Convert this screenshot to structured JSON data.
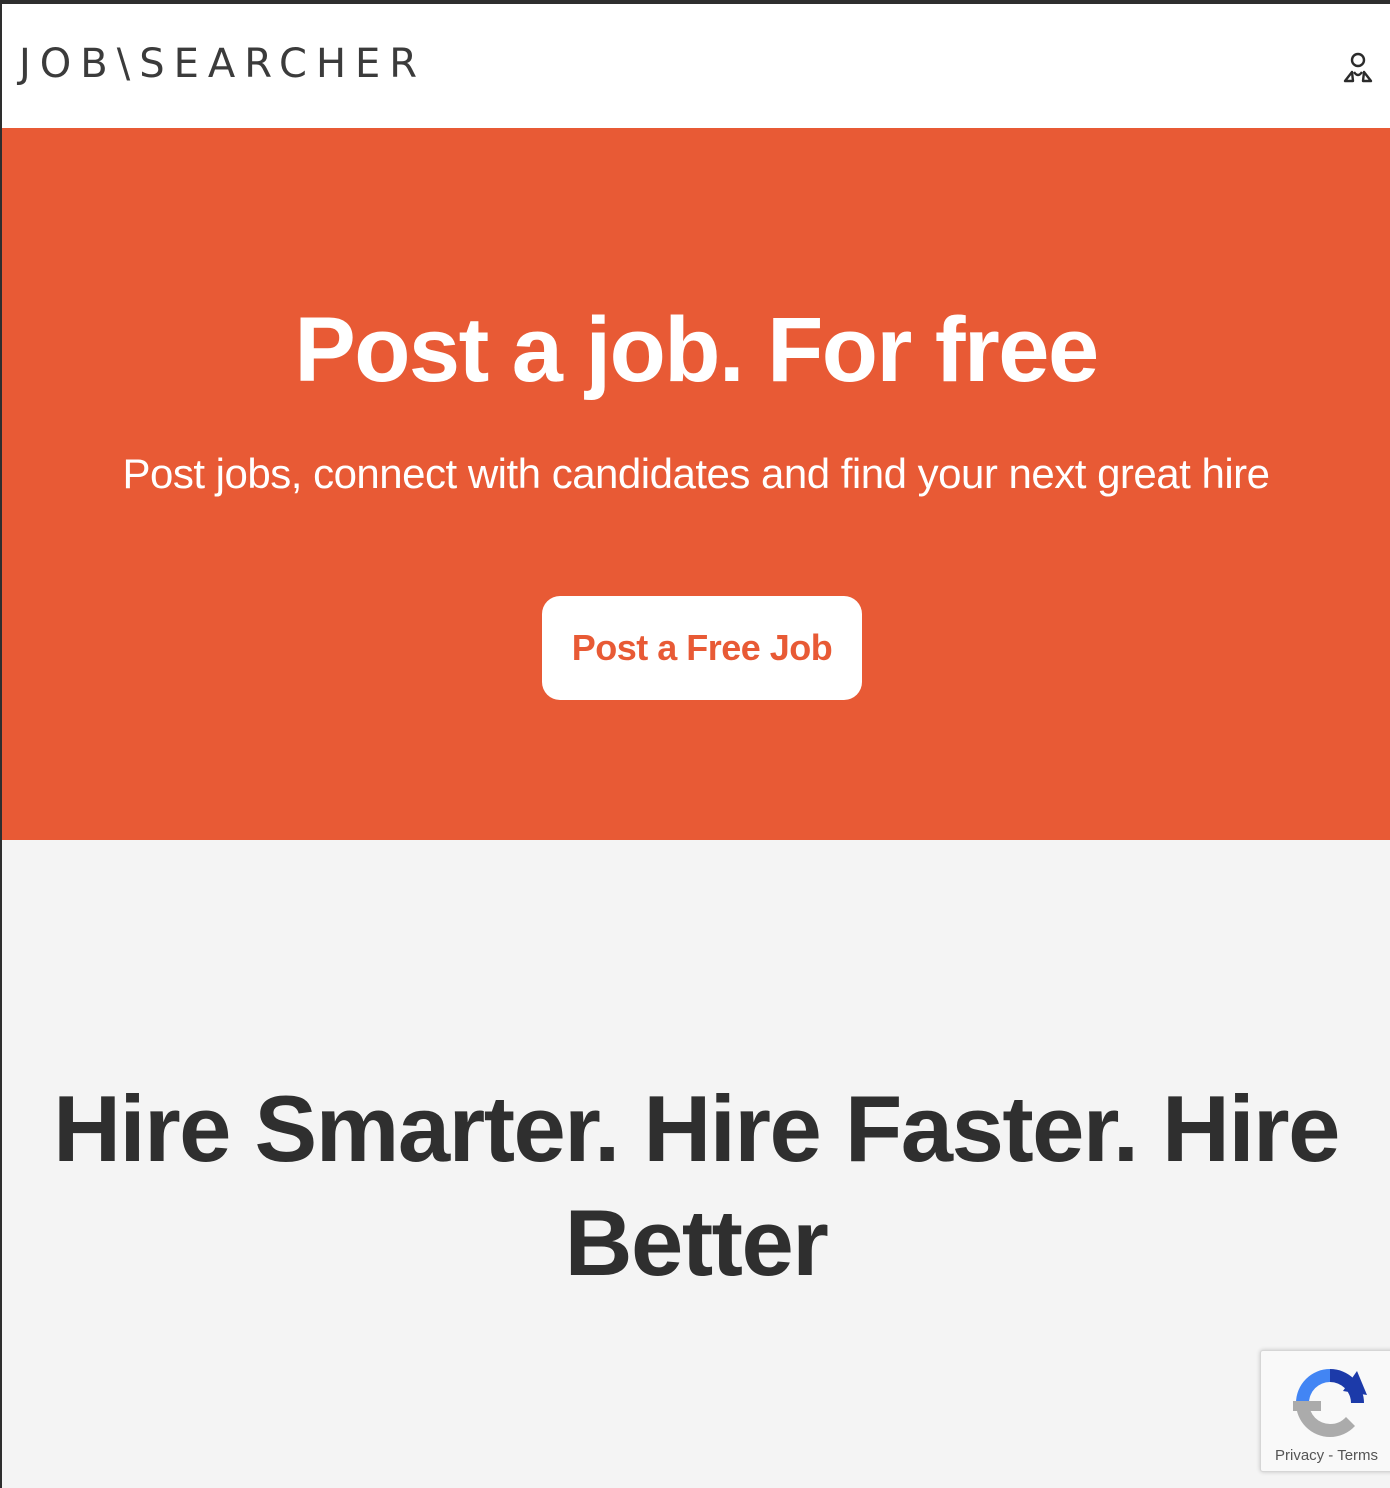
{
  "header": {
    "logo_text": "JOB\\SEARCHER",
    "account_icon": "user-account-icon"
  },
  "hero": {
    "title": "Post a job. For free",
    "subtitle": "Post jobs, connect with candidates and find your next great hire",
    "cta_label": "Post a Free Job",
    "background_color": "#e85a35"
  },
  "section": {
    "title": "Hire Smarter. Hire Faster. Hire Better"
  },
  "recaptcha": {
    "privacy_label": "Privacy",
    "separator": "-",
    "terms_label": "Terms",
    "icon": "recaptcha-icon"
  }
}
